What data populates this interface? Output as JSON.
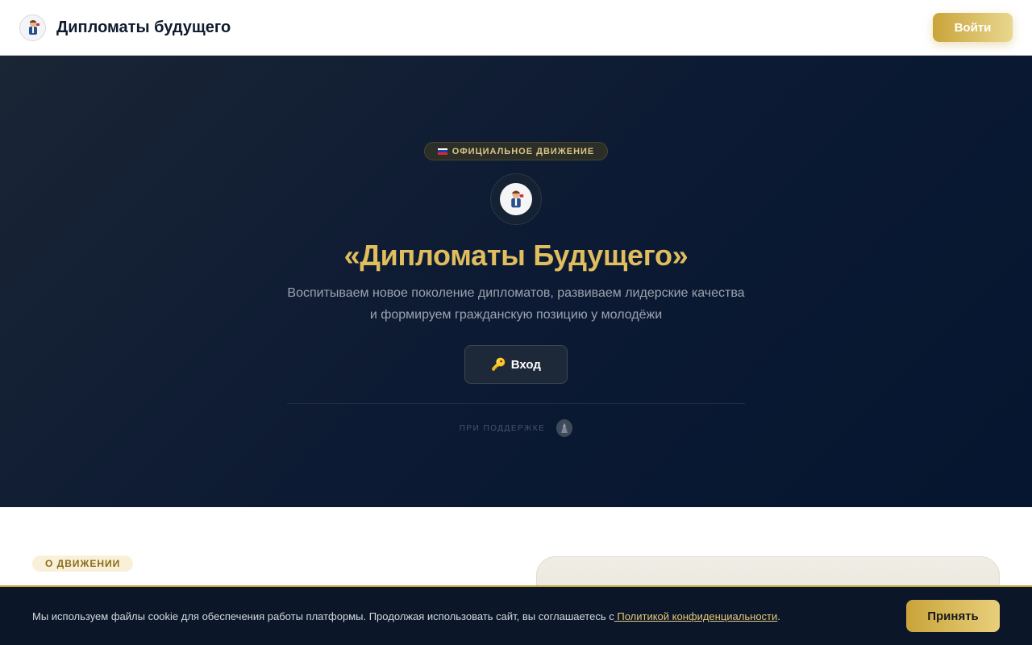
{
  "header": {
    "brand": "Дипломаты будущего",
    "login_label": "Войти"
  },
  "hero": {
    "badge": "ОФИЦИАЛЬНОЕ ДВИЖЕНИЕ",
    "title": "«Дипломаты Будущего»",
    "subtitle_line1": "Воспитываем новое поколение дипломатов, развиваем лидерские качества",
    "subtitle_line2": "и формируем гражданскую позицию у молодёжи",
    "enter_icon": "🔑",
    "enter_label": "Вход",
    "support_label": "ПРИ ПОДДЕРЖКЕ"
  },
  "about": {
    "tag": "О ДВИЖЕНИИ"
  },
  "cookie": {
    "text": "Мы используем файлы cookie для обеспечения работы платформы. Продолжая использовать сайт, вы соглашаетесь с",
    "link": " Политикой конфиденциальности",
    "suffix": ".",
    "accept_label": "Принять"
  },
  "colors": {
    "accent_gold": "#c9a43a",
    "hero_bg": "#0c1a33",
    "title_gold": "#e0bd5e"
  },
  "icons": {
    "logo": "mascot-logo-icon",
    "flag": "russian-flag-icon",
    "key": "key-icon",
    "support": "support-emblem-icon"
  }
}
